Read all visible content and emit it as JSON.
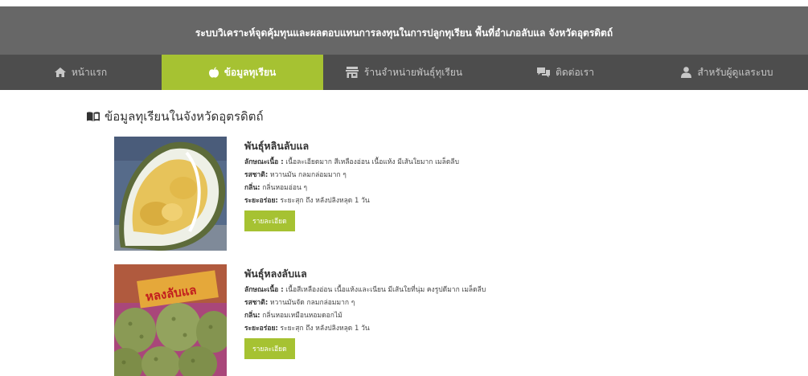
{
  "header": {
    "title": "ระบบวิเคราะห์จุดคุ้มทุนและผลตอบแทนการลงทุนในการปลูกทุเรียน พื้นที่อำเภอลับแล จังหวัดอุตรดิตถ์"
  },
  "nav": {
    "items": [
      {
        "label": "หน้าแรก",
        "icon": "home-icon"
      },
      {
        "label": "ข้อมูลทุเรียน",
        "icon": "apple-icon",
        "active": true
      },
      {
        "label": "ร้านจำหน่ายพันธุ์ทุเรียน",
        "icon": "store-icon"
      },
      {
        "label": "ติดต่อเรา",
        "icon": "chat-icon"
      },
      {
        "label": "สำหรับผู้ดูแลระบบ",
        "icon": "user-icon"
      }
    ]
  },
  "main": {
    "heading": "ข้อมูลทุเรียนในจังหวัดอุตรดิตถ์",
    "products": [
      {
        "name": "พันธุ์หลินลับแล",
        "texture_label": "ลักษณะเนื้อ :",
        "texture": "เนื้อละเอียดมาก สีเหลืองอ่อน เนื้อแห้ง มีเส้นใยมาก เมล็ดลีบ",
        "taste_label": "รสชาติ:",
        "taste": "หวานมัน กลมกล่อมมาก ๆ",
        "smell_label": "กลิ่น:",
        "smell": "กลิ่นหอมอ่อน ๆ",
        "period_label": "ระยะอร่อย:",
        "period": "ระยะสุก ถึง หลังปลิงหลุด 1 วัน",
        "button": "รายละเอียด"
      },
      {
        "name": "พันธุ์หลงลับแล",
        "texture_label": "ลักษณะเนื้อ :",
        "texture": "เนื้อสีเหลืองอ่อน เนื้อแห้งและเนียน มีเส้นใยที่นุ่ม คงรูปดีมาก เมล็ดลีบ",
        "taste_label": "รสชาติ:",
        "taste": "หวานมันจัด กลมกล่อมมาก ๆ",
        "smell_label": "กลิ่น:",
        "smell": "กลิ่นหอมเหมือนหอมดอกไม้",
        "period_label": "ระยะอร่อย:",
        "period": "ระยะสุก ถึง หลังปลิงหลุด 1 วัน",
        "button": "รายละเอียด",
        "photo_sign": "หลงลับแล"
      }
    ]
  },
  "colors": {
    "banner": "#676767",
    "nav": "#4d4d4d",
    "accent": "#a6c232"
  }
}
